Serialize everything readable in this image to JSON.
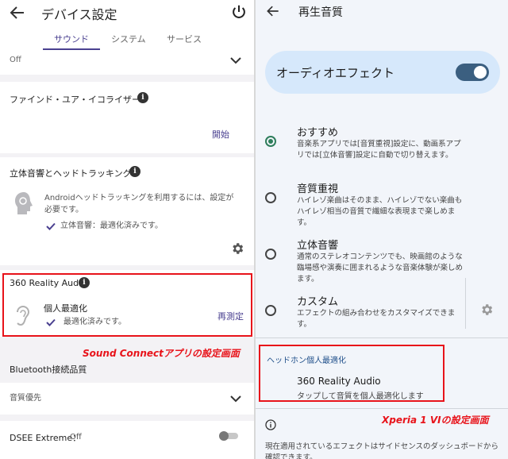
{
  "left": {
    "title": "デバイス設定",
    "tabs": [
      "サウンド",
      "システム",
      "サービス"
    ],
    "top_row_value": "Off",
    "eq": {
      "title": "ファインド・ユア・イコライザー",
      "action": "開始"
    },
    "spatial": {
      "title": "立体音響とヘッドトラッキング",
      "desc_line1": "Androidヘッドトラッキングを利用するには、設定が",
      "desc_line2": "必要です。",
      "status": "立体音響：最適化済みです。"
    },
    "reality": {
      "title": "360 Reality Audio",
      "item_title": "個人最適化",
      "item_status": "最適化済みです。",
      "action": "再測定"
    },
    "caption": "Sound Connectアプリの設定画面",
    "bluetooth": {
      "title": "Bluetooth接続品質",
      "value": "音質優先"
    },
    "dsee": {
      "label": "DSEE Extreme：",
      "value": "Off"
    }
  },
  "right": {
    "title": "再生音質",
    "audio_effect": {
      "label": "オーディオエフェクト",
      "enabled": true
    },
    "options": [
      {
        "title": "おすすめ",
        "desc": "音楽系アプリでは[音質重視]設定に、動画系アプリでは[立体音響]設定に自動で切り替えます。",
        "selected": true
      },
      {
        "title": "音質重視",
        "desc": "ハイレゾ楽曲はそのまま、ハイレゾでない楽曲もハイレゾ相当の音質で繊細な表現まで楽しめます。",
        "selected": false
      },
      {
        "title": "立体音響",
        "desc": "通常のステレオコンテンツでも、映画館のような臨場感や演奏に囲まれるような音楽体験が楽しめます。",
        "selected": false
      },
      {
        "title": "カスタム",
        "desc": "エフェクトの組み合わせをカスタマイズできます。",
        "selected": false
      }
    ],
    "headphone": {
      "section": "ヘッドホン個人最適化",
      "title": "360 Reality Audio",
      "desc": "タップして音質を個人最適化します"
    },
    "caption": "Xperia 1 VIの設定画面",
    "footer": "現在適用されているエフェクトはサイドセンスのダッシュボードから確認できます。"
  },
  "colors": {
    "accent_purple": "#4a4090",
    "accent_green": "#2e7d5b",
    "highlight_red": "#e8131a",
    "pill_blue": "#d6e8fb",
    "toggle_on": "#3b5f80"
  }
}
